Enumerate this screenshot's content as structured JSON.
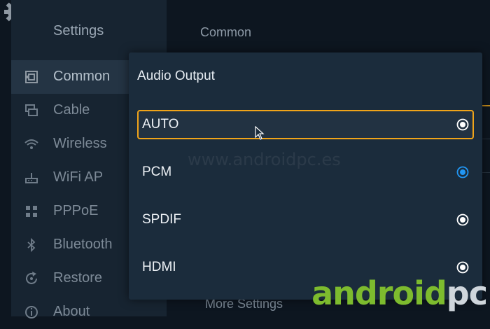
{
  "sidebar": {
    "title": "Settings",
    "items": [
      {
        "label": "Common",
        "icon": "common-icon",
        "active": true
      },
      {
        "label": "Cable",
        "icon": "cable-icon"
      },
      {
        "label": "Wireless",
        "icon": "wireless-icon"
      },
      {
        "label": "WiFi AP",
        "icon": "wifi-ap-icon"
      },
      {
        "label": "PPPoE",
        "icon": "pppoe-icon"
      },
      {
        "label": "Bluetooth",
        "icon": "bluetooth-icon"
      },
      {
        "label": "Restore",
        "icon": "restore-icon"
      },
      {
        "label": "About",
        "icon": "about-icon"
      }
    ]
  },
  "main": {
    "title": "Common",
    "more_settings": "More Settings"
  },
  "dialog": {
    "title": "Audio Output",
    "options": [
      {
        "label": "AUTO",
        "selected": false,
        "focused": true
      },
      {
        "label": "PCM",
        "selected": true,
        "focused": false
      },
      {
        "label": "SPDIF",
        "selected": false,
        "focused": false
      },
      {
        "label": "HDMI",
        "selected": false,
        "focused": false
      }
    ]
  },
  "watermark": {
    "text": "www.androidpc.es"
  },
  "logo": {
    "part1": "android",
    "part2": "pc"
  },
  "colors": {
    "background": "#0d1620",
    "sidebar": "#172431",
    "dialog": "#1b2c3c",
    "focus_border": "#f0a419",
    "radio_selected": "#2196f3",
    "radio_unselected": "#ffffff",
    "logo_green": "#7dbb2e"
  }
}
